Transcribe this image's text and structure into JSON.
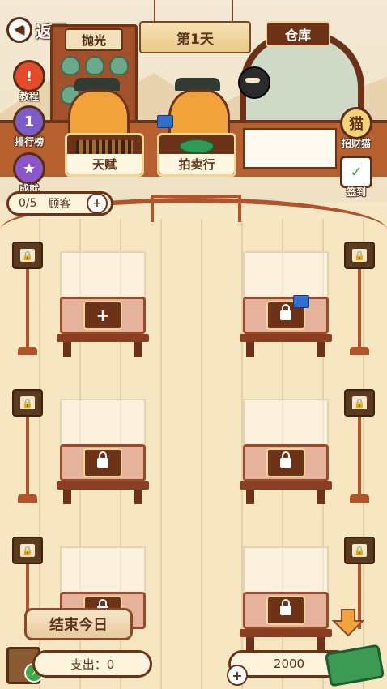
{
  "header": {
    "back_label": "返回",
    "day_label": "第1天",
    "polish_label": "抛光",
    "warehouse_label": "仓库"
  },
  "side_left": [
    {
      "label": "教程",
      "icon": "exclamation-icon"
    },
    {
      "label": "排行榜",
      "icon": "trophy-icon"
    },
    {
      "label": "成就",
      "icon": "star-medal-icon"
    }
  ],
  "side_right": [
    {
      "label": "招财猫",
      "icon": "lucky-cat-icon"
    },
    {
      "label": "签到",
      "icon": "calendar-check-icon"
    }
  ],
  "shop_buttons": {
    "talent": "天赋",
    "auction": "拍卖行"
  },
  "customers": {
    "count": "0/5",
    "label": "顾客"
  },
  "slots": [
    {
      "state": "empty",
      "symbol": "+"
    },
    {
      "state": "locked",
      "video": true
    },
    {
      "state": "locked"
    },
    {
      "state": "locked"
    },
    {
      "state": "locked"
    },
    {
      "state": "locked"
    }
  ],
  "footer": {
    "end_day_label": "结束今日",
    "expense_label": "支出：0",
    "money_value": "2000"
  }
}
